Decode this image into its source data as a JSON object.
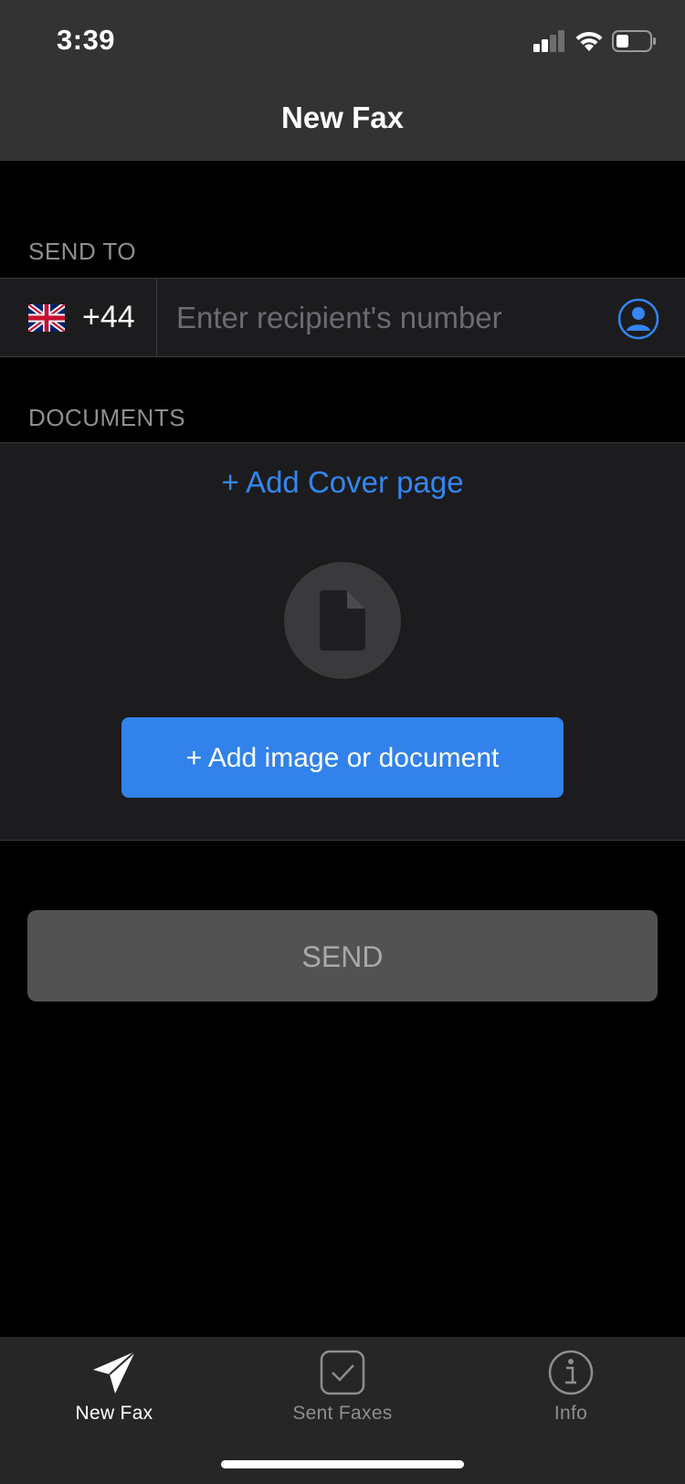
{
  "status_bar": {
    "time": "3:39"
  },
  "nav": {
    "title": "New Fax"
  },
  "send_to": {
    "section_label": "SEND TO",
    "country_flag": "uk-flag",
    "country_code": "+44",
    "recipient_placeholder": "Enter recipient's number",
    "recipient_value": "",
    "contact_icon": "person-circle-icon"
  },
  "documents": {
    "section_label": "DOCUMENTS",
    "add_cover_label": "+ Add Cover page",
    "placeholder_icon": "document-icon",
    "add_document_label": "+ Add image or document"
  },
  "send_button": {
    "label": "SEND"
  },
  "tab_bar": {
    "tabs": [
      {
        "label": "New Fax",
        "icon": "paper-plane-icon",
        "selected": true
      },
      {
        "label": "Sent Faxes",
        "icon": "checkmark-square-icon",
        "selected": false
      },
      {
        "label": "Info",
        "icon": "info-circle-icon",
        "selected": false
      }
    ]
  },
  "colors": {
    "accent": "#3486f0",
    "button_blue": "#3182ea",
    "send_disabled_bg": "#525252",
    "bar_bg": "#333333",
    "tab_selected": "#ffffff",
    "tab_unselected": "#8e8e93"
  }
}
